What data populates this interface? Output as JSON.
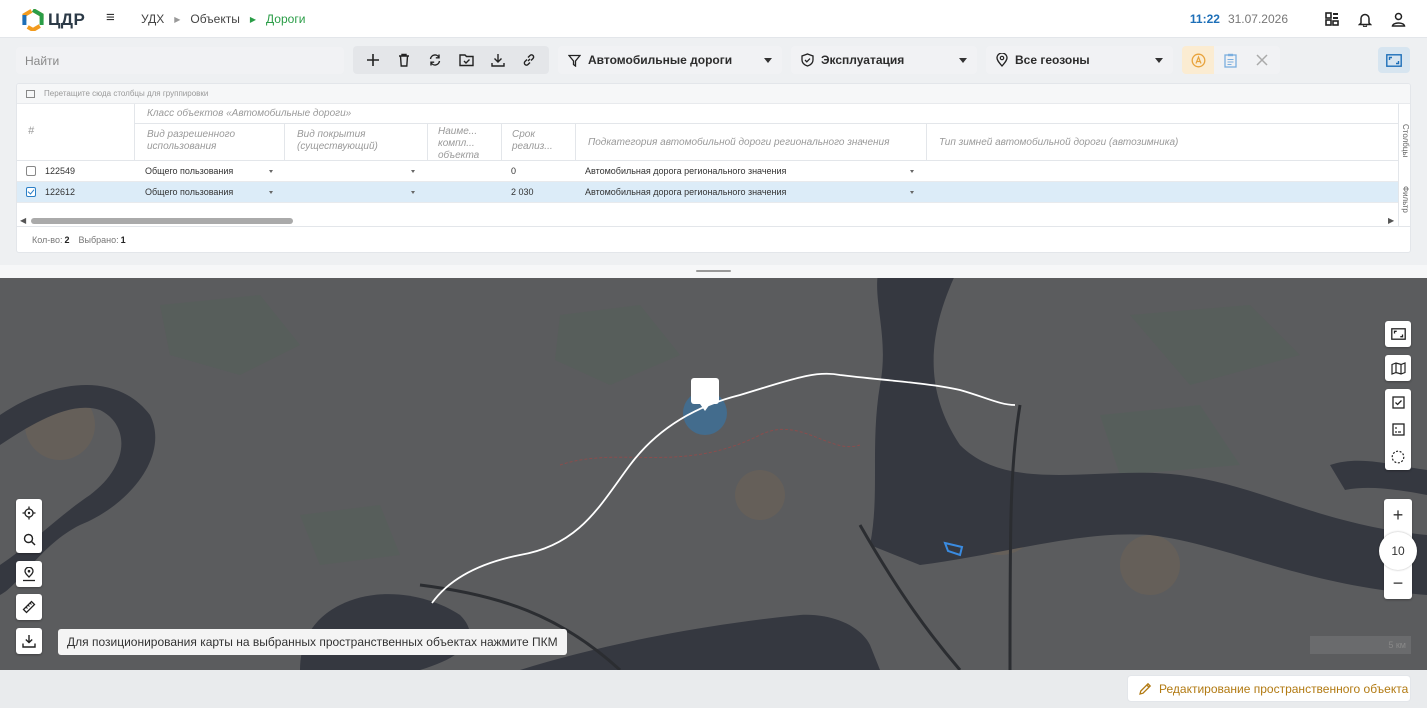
{
  "header": {
    "logo_text": "ЦДР",
    "breadcrumbs": [
      "УДХ",
      "Объекты",
      "Дороги"
    ],
    "time": "11:22",
    "date": "31.07.2026"
  },
  "toolbar": {
    "search_placeholder": "Найти",
    "filter_roads": "Автомобильные дороги",
    "filter_status": "Эксплуатация",
    "filter_geozone": "Все геозоны"
  },
  "grid": {
    "group_hint": "Перетащите сюда столбцы для группировки",
    "hash_header": "#",
    "class_header": "Класс объектов «Автомобильные дороги»",
    "columns": [
      "Вид разрешенного использования",
      "Вид покрытия (существующий)",
      "Наиме... компл... объекта",
      "Срок реализ...",
      "Подкатегория автомобильной дороги регионального значения",
      "Тип зимней автомобильной дороги (автозимника)"
    ],
    "side_tabs": [
      "Столбцы",
      "Фильтр"
    ],
    "rows": [
      {
        "id": "122549",
        "usage": "Общего пользования",
        "term": "0",
        "subcategory": "Автомобильная дорога регионального значения"
      },
      {
        "id": "122612",
        "usage": "Общего пользования",
        "term": "2 030",
        "subcategory": "Автомобильная дорога регионального значения"
      }
    ],
    "count_label": "Кол-во:",
    "count_value": "2",
    "selected_label": "Выбрано:",
    "selected_value": "1"
  },
  "map": {
    "zoom_level": "10",
    "tooltip": "Для позиционирования карты на выбранных пространственных объектах нажмите ПКМ",
    "scale_label": "5 км"
  },
  "edit_button_label": "Редактирование пространственного объекта",
  "colors": {
    "accent_green": "#2a9d47",
    "accent_blue": "#1d6fb8",
    "edit_amber": "#b27a12"
  }
}
